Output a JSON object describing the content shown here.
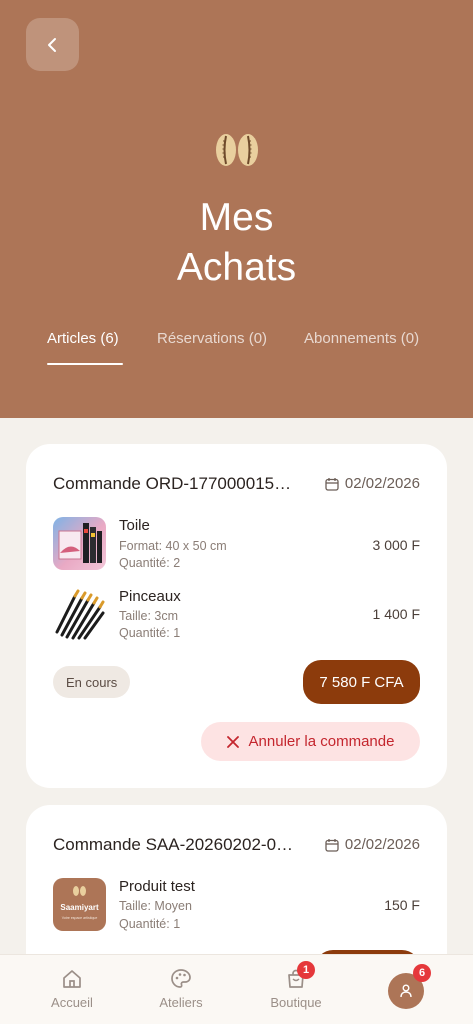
{
  "header": {
    "title_line1": "Mes",
    "title_line2": "Achats",
    "back_icon": "chevron-left-icon",
    "logo_icon": "cowrie-shells-logo"
  },
  "tabs": [
    {
      "label": "Articles (6)",
      "active": true
    },
    {
      "label": "Réservations (0)",
      "active": false
    },
    {
      "label": "Abonnements (0)",
      "active": false
    }
  ],
  "orders": [
    {
      "id": "Commande ORD-177000015…",
      "date": "02/02/2026",
      "items": [
        {
          "name": "Toile",
          "detail": "Format: 40 x 50 cm",
          "quantity": "Quantité: 2",
          "price": "3 000 F"
        },
        {
          "name": "Pinceaux",
          "detail": "Taille: 3cm",
          "quantity": "Quantité: 1",
          "price": "1 400 F"
        }
      ],
      "status": "En cours",
      "total": "7 580 F CFA",
      "cancel_label": "Annuler la commande"
    },
    {
      "id": "Commande SAA-20260202-0…",
      "date": "02/02/2026",
      "items": [
        {
          "name": "Produit test",
          "detail": "Taille: Moyen",
          "quantity": "Quantité: 1",
          "price": "150 F",
          "thumb_brand": "Saamiyart",
          "thumb_tagline": "Votre espace artistique"
        }
      ]
    }
  ],
  "bottom_nav": [
    {
      "label": "Accueil",
      "icon": "home-icon"
    },
    {
      "label": "Ateliers",
      "icon": "palette-icon"
    },
    {
      "label": "Boutique",
      "icon": "shopping-bag-icon",
      "badge": "1"
    },
    {
      "label": "",
      "icon": "user-icon",
      "badge": "6"
    }
  ],
  "colors": {
    "header_bg": "#ad7557",
    "accent_dark": "#8c3b0c",
    "cancel_bg": "#fde3e3",
    "cancel_text": "#c4262e",
    "badge": "#e5383b"
  }
}
